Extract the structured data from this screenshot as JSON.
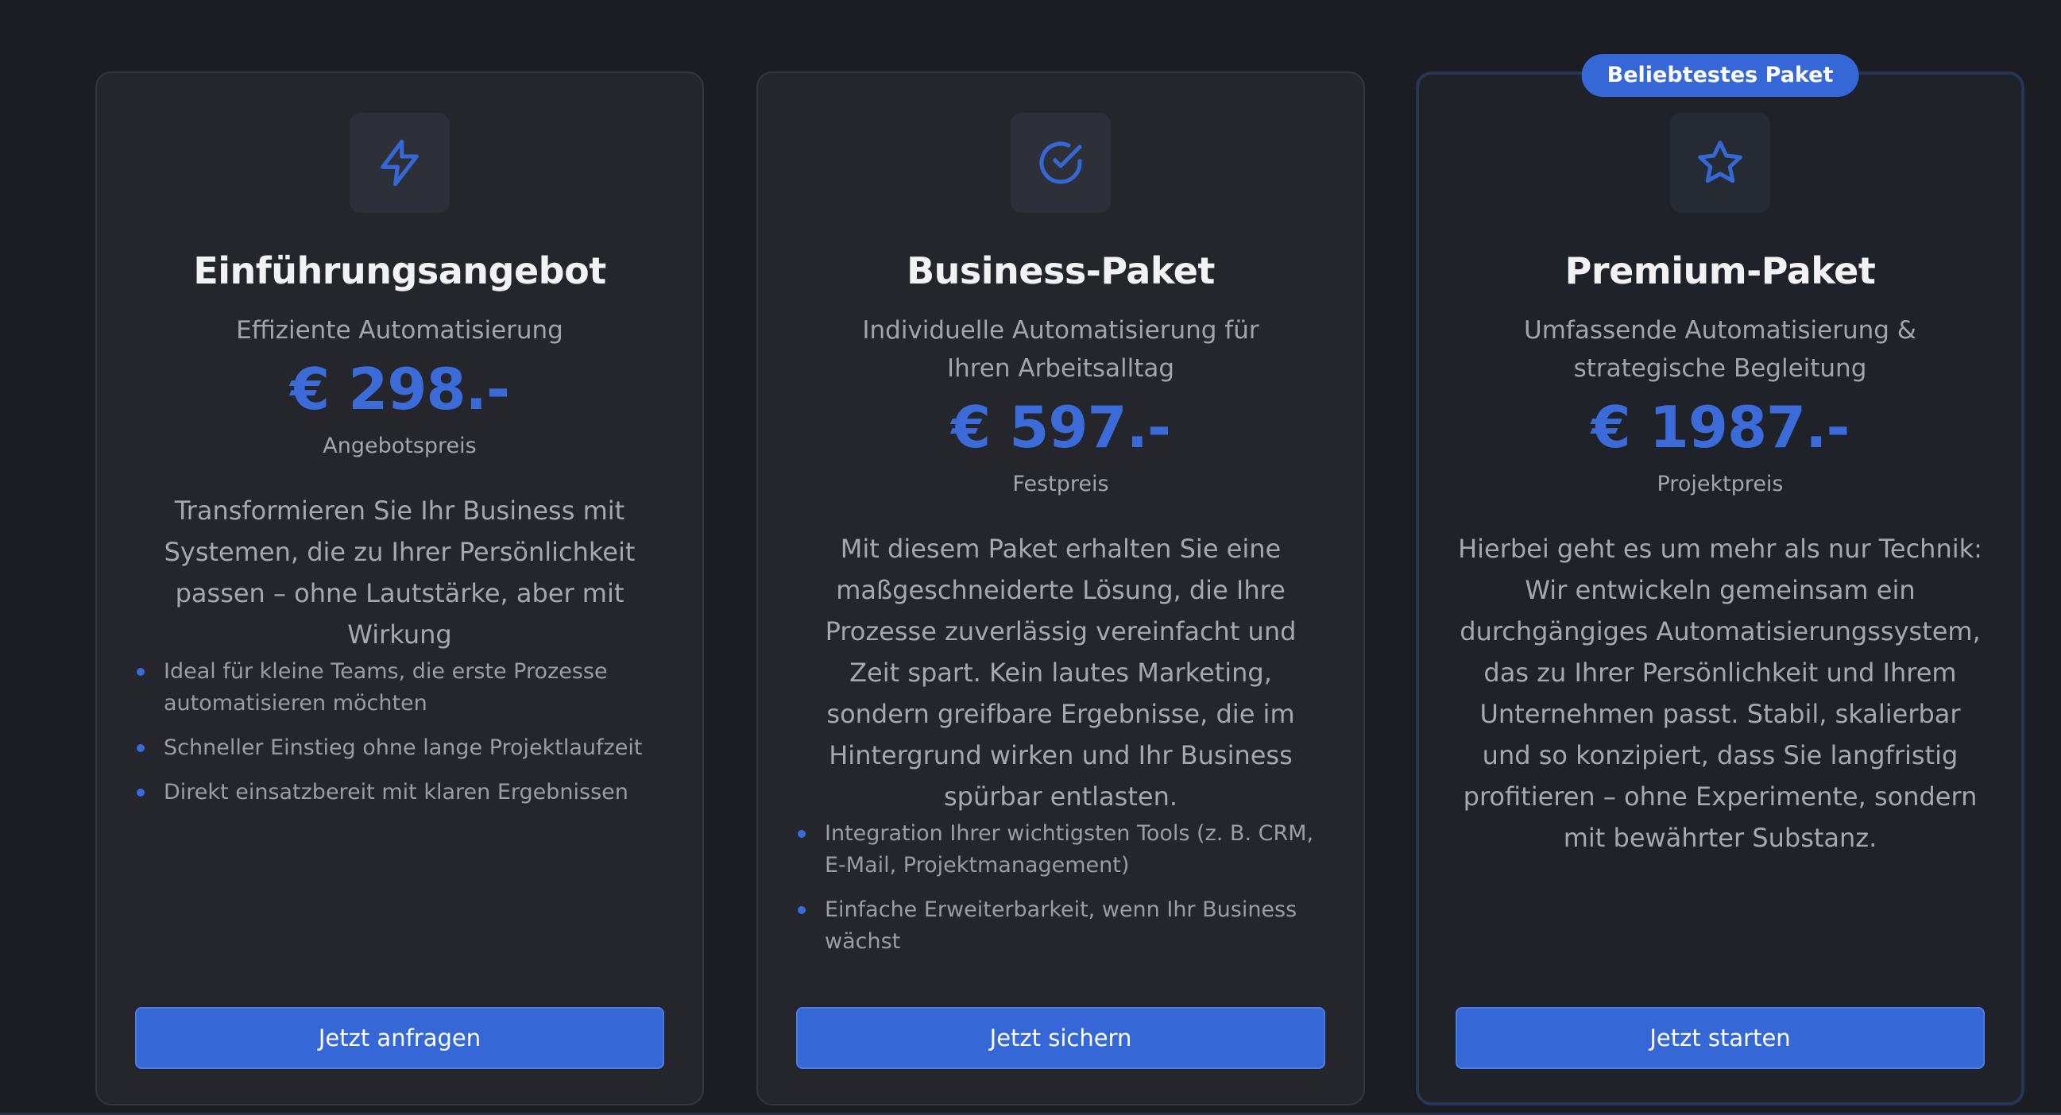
{
  "colors": {
    "background": "#1c1d22",
    "card": "#25262b",
    "accent": "#3567d6",
    "price": "#3a6bd8"
  },
  "plans": [
    {
      "icon": "lightning-bolt-icon",
      "title": "Einführungsangebot",
      "subtitle": "Effiziente Automatisierung",
      "price": "€ 298.-",
      "price_label": "Angebotspreis",
      "description": "Transformieren Sie Ihr Business mit Systemen, die zu Ihrer Persönlichkeit passen – ohne Lautstärke, aber mit Wirkung",
      "features": [
        "Ideal für kleine Teams, die erste Prozesse automatisieren möchten",
        "Schneller Einstieg ohne lange Projektlaufzeit",
        "Direkt einsatzbereit mit klaren Ergebnissen"
      ],
      "cta": "Jetzt anfragen"
    },
    {
      "icon": "check-circle-icon",
      "title": "Business-Paket",
      "subtitle": "Individuelle Automatisierung für Ihren Arbeitsalltag",
      "price": "€ 597.-",
      "price_label": "Festpreis",
      "description": "Mit diesem Paket erhalten Sie eine maßgeschneiderte Lösung, die Ihre Prozesse zuverlässig vereinfacht und Zeit spart. Kein lautes Marketing, sondern greifbare Ergebnisse, die im Hintergrund wirken und Ihr Business spürbar entlasten.",
      "features": [
        "Integration Ihrer wichtigsten Tools (z. B. CRM, E-Mail, Projektmanagement)",
        "Einfache Erweiterbarkeit, wenn Ihr Business wächst"
      ],
      "cta": "Jetzt sichern"
    },
    {
      "icon": "star-icon",
      "badge": "Beliebtestes Paket",
      "title": "Premium-Paket",
      "subtitle": "Umfassende Automatisierung & strategische Begleitung",
      "price": "€ 1987.-",
      "price_label": "Projektpreis",
      "description": "Hierbei geht es um mehr als nur Technik: Wir entwickeln gemeinsam ein durchgängiges Automatisierungssystem, das zu Ihrer Persönlichkeit und Ihrem Unternehmen passt. Stabil, skalierbar und so konzipiert, dass Sie langfristig profitieren – ohne Experimente, sondern mit bewährter Substanz.",
      "features": [],
      "cta": "Jetzt starten"
    }
  ]
}
